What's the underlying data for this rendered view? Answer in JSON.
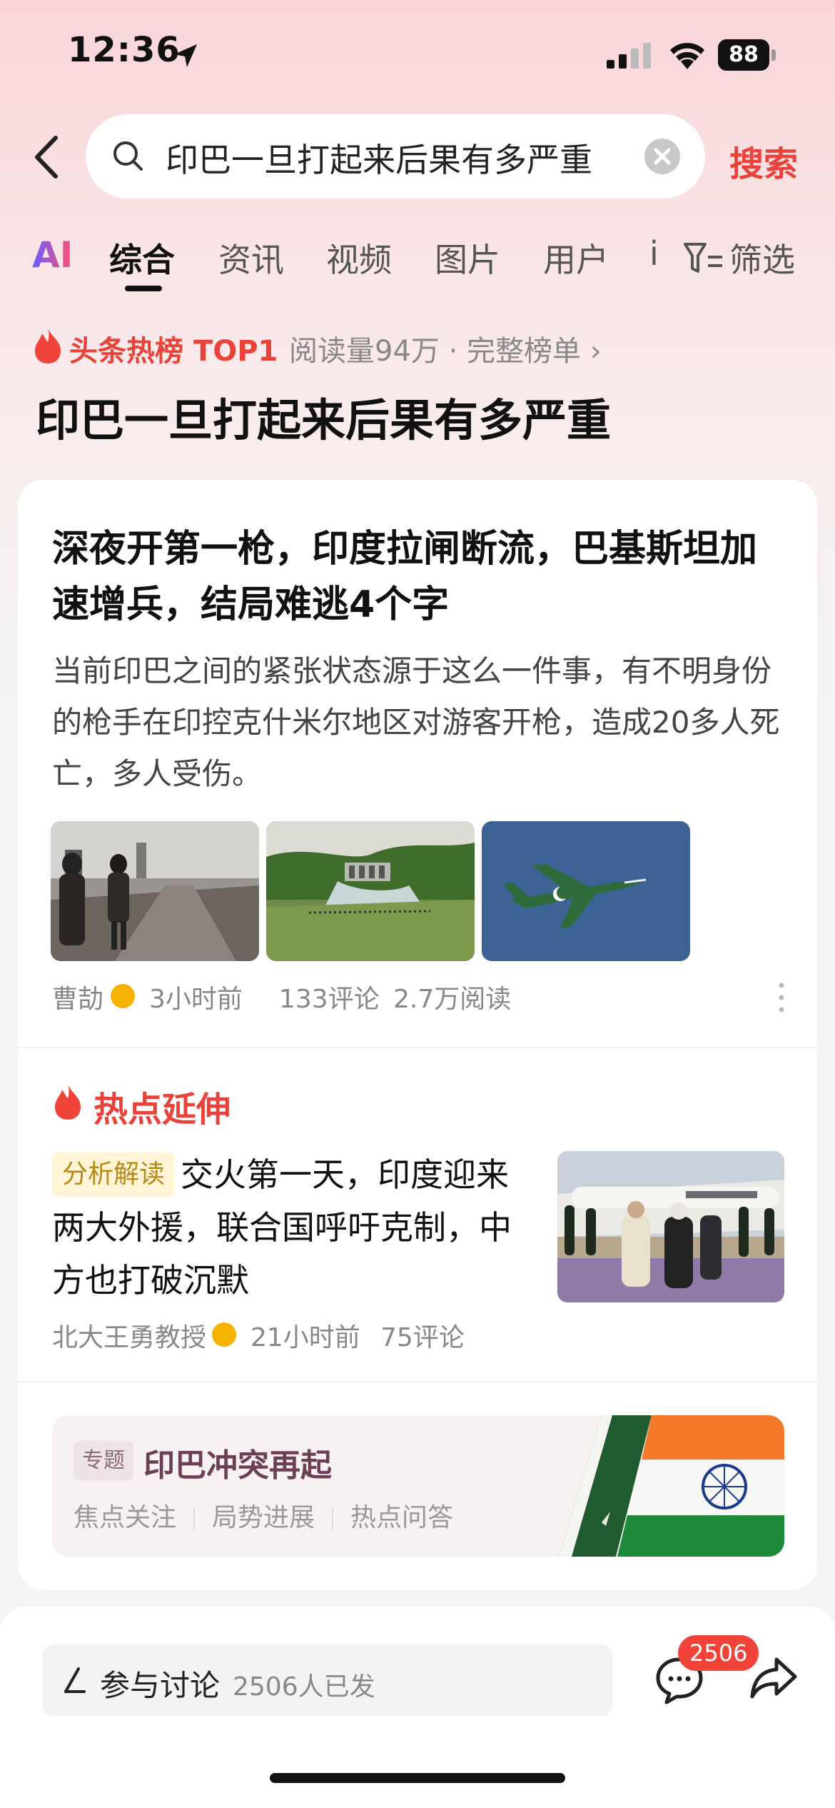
{
  "status_bar": {
    "time": "12:36",
    "battery": "88"
  },
  "search": {
    "query": "印巴一旦打起来后果有多严重",
    "button_label": "搜索"
  },
  "tabs": [
    "AI",
    "综合",
    "资讯",
    "视频",
    "图片",
    "用户",
    "i"
  ],
  "tabs_filter_label": "筛选",
  "hot": {
    "label": "头条热榜 TOP1",
    "meta": "阅读量94万 · 完整榜单 ›"
  },
  "topic_title": "印巴一旦打起来后果有多严重",
  "article": {
    "title": "深夜开第一枪，印度拉闸断流，巴基斯坦加速增兵，结局难逃4个字",
    "summary": "当前印巴之间的紧张状态源于这么一件事，有不明身份的枪手在印控克什米尔地区对游客开枪，造成20多人死亡，多人受伤。",
    "author": "曹劼",
    "time": "3小时前",
    "comments": "133评论",
    "reads": "2.7万阅读"
  },
  "extension": {
    "label": "热点延伸",
    "tag": "分析解读",
    "title": "交火第一天，印度迎来两大外援，联合国呼吁克制，中方也打破沉默",
    "author": "北大王勇教授",
    "time": "21小时前",
    "comments": "75评论"
  },
  "special_topic": {
    "tag": "专题",
    "name": "印巴冲突再起",
    "links": [
      "焦点关注",
      "局势进展",
      "热点问答"
    ]
  },
  "bottom": {
    "input_label": "参与讨论",
    "input_count": "2506人已发",
    "badge": "2506"
  },
  "colors": {
    "accent": "#e8433b",
    "badge": "#f0443a",
    "tag_bg": "#fff4d6"
  }
}
